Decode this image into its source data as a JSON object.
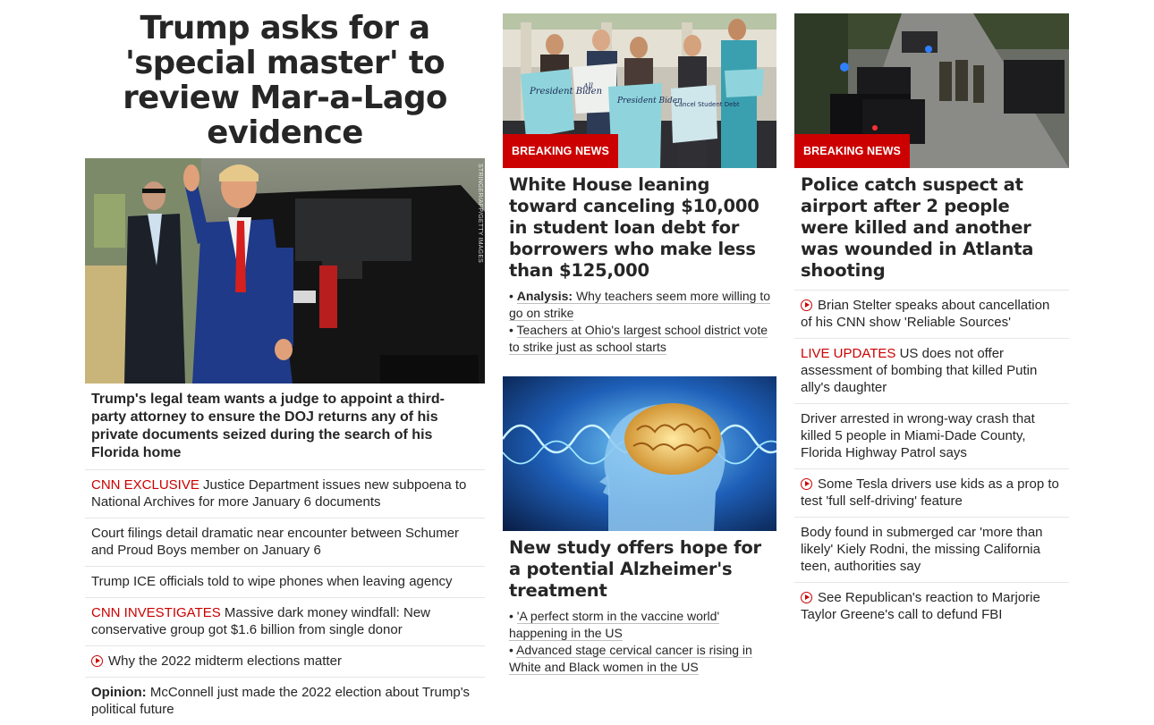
{
  "col1": {
    "headline": "Trump asks for a 'special master' to review Mar-a-Lago evidence",
    "photo_credit": "STRINGER/AFP/GETTY IMAGES",
    "lead": "Trump's legal team wants a judge to appoint a third-party attorney to ensure the DOJ returns any of his private documents seized during the search of his Florida home",
    "items": [
      {
        "kicker": "CNN EXCLUSIVE",
        "text": "Justice Department issues new subpoena to National Archives for more January 6 documents"
      },
      {
        "text": "Court filings detail dramatic near encounter between Schumer and Proud Boys member on January 6"
      },
      {
        "text": "Trump ICE officials told to wipe phones when leaving agency"
      },
      {
        "kicker": "CNN INVESTIGATES",
        "text": "Massive dark money windfall: New conservative group got $1.6 billion from single donor"
      },
      {
        "icon": "play-icon",
        "text": "Why the 2022 midterm elections matter"
      },
      {
        "label": "Opinion:",
        "text": "McConnell just made the 2022 election about Trump's political future"
      }
    ]
  },
  "col2": {
    "card1": {
      "badge": "BREAKING NEWS",
      "sign_texts": [
        "President Biden",
        "Cancel Student Debt",
        "All"
      ],
      "headline": "White House leaning toward canceling $10,000 in student loan debt for borrowers who make less than $125,000",
      "bullets": [
        {
          "label": "Analysis:",
          "text": "Why teachers seem more willing to go on strike"
        },
        {
          "text": "Teachers at Ohio's largest school district vote to strike just as school starts"
        }
      ]
    },
    "card2": {
      "headline": "New study offers hope for a potential Alzheimer's treatment",
      "bullets": [
        {
          "text": "'A perfect storm in the vaccine world' happening in the US"
        },
        {
          "text": "Advanced stage cervical cancer is rising in White and Black women in the US"
        }
      ]
    }
  },
  "col3": {
    "badge": "BREAKING NEWS",
    "headline": "Police catch suspect at airport after 2 people were killed and another was wounded in Atlanta shooting",
    "items": [
      {
        "icon": "play-icon",
        "text": "Brian Stelter speaks about cancellation of his CNN show 'Reliable Sources'"
      },
      {
        "kicker": "LIVE UPDATES",
        "text": "US does not offer assessment of bombing that killed Putin ally's daughter"
      },
      {
        "text": "Driver arrested in wrong-way crash that killed 5 people in Miami-Dade County, Florida Highway Patrol says"
      },
      {
        "icon": "play-icon",
        "text": "Some Tesla drivers use kids as a prop to test 'full self-driving' feature"
      },
      {
        "text": "Body found in submerged car 'more than likely' Kiely Rodni, the missing California teen, authorities say"
      },
      {
        "icon": "play-icon",
        "text": "See Republican's reaction to Marjorie Taylor Greene's call to defund FBI"
      }
    ]
  },
  "colors": {
    "accent": "#cc0000",
    "text": "#262626",
    "divider": "#e6e6e6"
  }
}
